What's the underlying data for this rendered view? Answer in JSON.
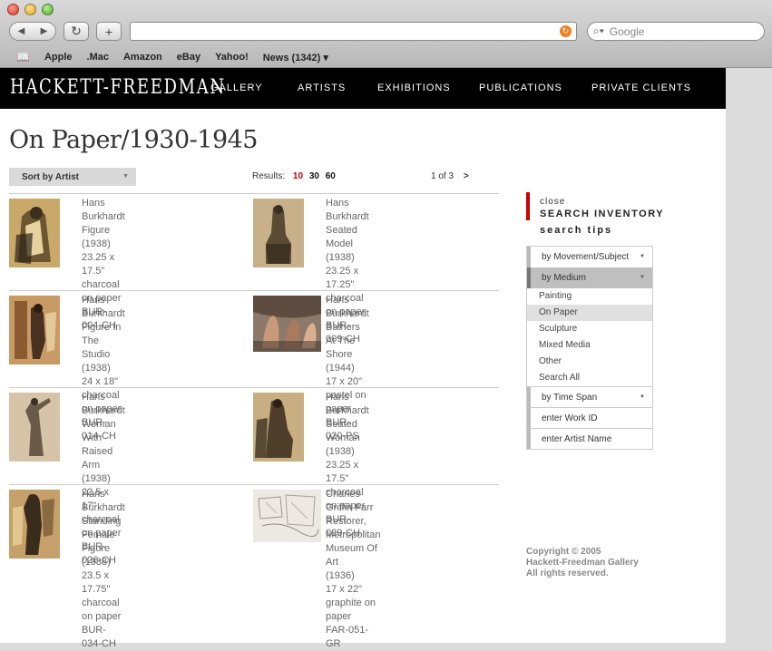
{
  "browser": {
    "search_placeholder": "Google",
    "bookmarks": [
      "Apple",
      ".Mac",
      "Amazon",
      "eBay",
      "Yahoo!",
      "News (1342) ▾"
    ]
  },
  "site": {
    "logo": "HACKETT-FREEDMAN",
    "nav": [
      "GALLERY",
      "ARTISTS",
      "EXHIBITIONS",
      "PUBLICATIONS",
      "PRIVATE CLIENTS"
    ]
  },
  "page_title": "On Paper/1930-1945",
  "sort_label": "Sort by Artist",
  "results": {
    "label": "Results:",
    "options": [
      "10",
      "30",
      "60"
    ],
    "active": "10",
    "pagination": "1 of 3",
    "next": ">"
  },
  "items": [
    {
      "artist": "Hans Burkhardt",
      "title": "Figure (1938)",
      "size": "23.25 x 17.5\"",
      "medium": "charcoal on paper",
      "code": "BUR-004-CH",
      "thumb": "cubist-figure"
    },
    {
      "artist": "Hans Burkhardt",
      "title": "Seated Model (1938)",
      "size": "23.25 x 17.25\"",
      "medium": "charcoal on paper",
      "code": "BUR-009-CH",
      "thumb": "seated-model"
    },
    {
      "artist": "Hans Burkhardt",
      "title": "Figure In The Studio (1938)",
      "size": "24 x 18\"",
      "medium": "charcoal on paper",
      "code": "BUR-014-CH",
      "thumb": "studio-figure"
    },
    {
      "artist": "Hans Burkhardt",
      "title": "Bathers At The Shore (1944)",
      "size": "17 x 20\"",
      "medium": "pastel on paper",
      "code": "BUR-020-PS",
      "thumb": "bathers"
    },
    {
      "artist": "Hans Burkhardt",
      "title": "Woman With Raised Arm (1938)",
      "size": "22.5 x 17\"",
      "medium": "charcoal on paper",
      "code": "BUR-026-CH",
      "thumb": "woman-raised-arm"
    },
    {
      "artist": "Hans Burkhardt",
      "title": "Seated Woman (1938)",
      "size": "23.25 x 17.5\"",
      "medium": "charcoal on paper",
      "code": "BUR-029-CH",
      "thumb": "seated-woman"
    },
    {
      "artist": "Hans Burkhardt",
      "title": "Standing Female Figure (1938)",
      "size": "23.5 x 17.75\"",
      "medium": "charcoal on paper",
      "code": "BUR-034-CH",
      "thumb": "standing-female"
    },
    {
      "artist": "Charles Griffin Farr",
      "title": "Restorer, Metropolitan Museum Of Art",
      "title2": "(1936)",
      "size": "17 x 22\"",
      "medium": "graphite on paper",
      "code": "FAR-051-GR",
      "thumb": "restorer-sketch"
    }
  ],
  "sidebar": {
    "close": "close",
    "search_inventory": "SEARCH INVENTORY",
    "search_tips": "search tips",
    "movement": "by Movement/Subject",
    "medium": "by Medium",
    "medium_options": [
      "Painting",
      "On Paper",
      "Sculpture",
      "Mixed Media",
      "Other",
      "Search All"
    ],
    "medium_selected": "On Paper",
    "time_span": "by Time Span",
    "work_id": "enter Work ID",
    "artist_name": "enter Artist Name"
  },
  "copyright": [
    "Copyright © 2005",
    "Hackett-Freedman Gallery",
    "All rights reserved."
  ]
}
